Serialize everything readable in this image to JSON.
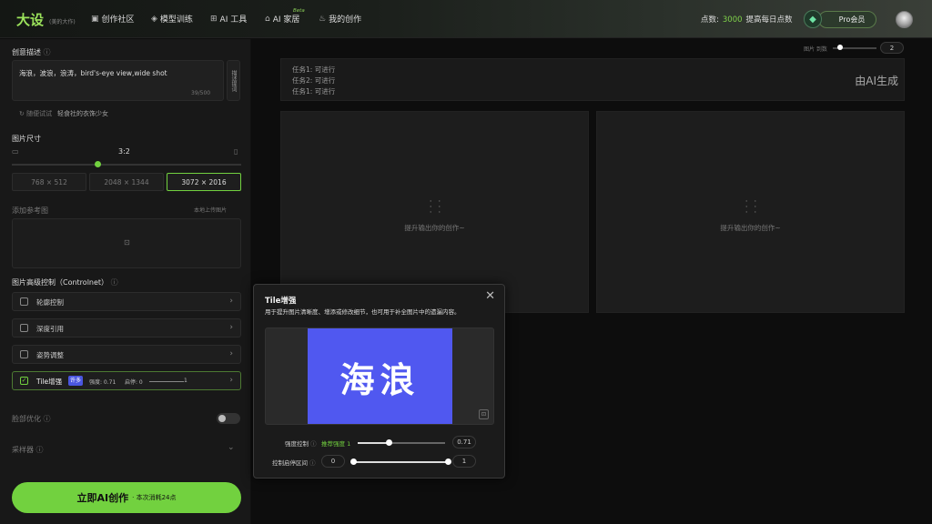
{
  "header": {
    "logo": "大设",
    "logo_sub": "(美的大作)",
    "nav": [
      {
        "label": "创作社区",
        "icon": "grid-icon"
      },
      {
        "label": "模型训练",
        "icon": "model-icon"
      },
      {
        "label": "AI 工具",
        "icon": "tools-icon"
      },
      {
        "label": "AI 家居",
        "icon": "home-icon"
      },
      {
        "label": "我的创作",
        "icon": "bulb-icon"
      }
    ],
    "beta": "Beta",
    "points_label": "点数:",
    "points_value": "3000",
    "points_action": "提高每日点数",
    "pro_label": "Pro会员"
  },
  "left": {
    "prompt_label": "创意描述",
    "prompt_text": "海浪，波浪，浪涛，bird's-eye view,wide shot",
    "prompt_side_btn": "描述提词",
    "prompt_count": "39/500",
    "try_label": "随便试试",
    "try_example": "轻食社的衣饰少女",
    "size_label": "图片尺寸",
    "ratio": "3:2",
    "sizes": [
      "768 × 512",
      "2048 × 1344",
      "3072 × 2016"
    ],
    "ref_label": "添加参考图",
    "ref_action": "本地上传图片",
    "controlnet_label": "图片高级控制（Controlnet）",
    "controls": [
      {
        "label": "轮廓控制",
        "checked": false
      },
      {
        "label": "深度引用",
        "checked": false
      },
      {
        "label": "姿势调整",
        "checked": false
      },
      {
        "label": "Tile增强",
        "checked": true,
        "tag": "许多",
        "strength": "强度: 0.71",
        "start": "启停: 0",
        "end": "1"
      }
    ],
    "face_label": "脸部优化",
    "seed_label": "采样器",
    "generate_label": "立即AI创作",
    "generate_cost": "· 本次消耗24点"
  },
  "main": {
    "count_label": "图片 到数",
    "count_value": "2",
    "tasks": [
      {
        "label": "任务1:",
        "status": "可进行"
      },
      {
        "label": "任务2:",
        "status": "可进行"
      },
      {
        "label": "任务1:",
        "status": "可进行"
      }
    ],
    "ai_gen": "由AI生成",
    "placeholder": "提升输出你的创作~"
  },
  "modal": {
    "title": "Tile增强",
    "desc": "用于提升图片清晰度、增添或修改细节，也可用于补全图片中的遗漏内容。",
    "preview_text": "海浪",
    "strength_label": "强度控制",
    "strength_hint": "推荐强度 1",
    "strength_value": "0.71",
    "range_label": "控制启停区间",
    "range_start": "0",
    "range_end": "1",
    "strength_fraction": 0.71
  }
}
